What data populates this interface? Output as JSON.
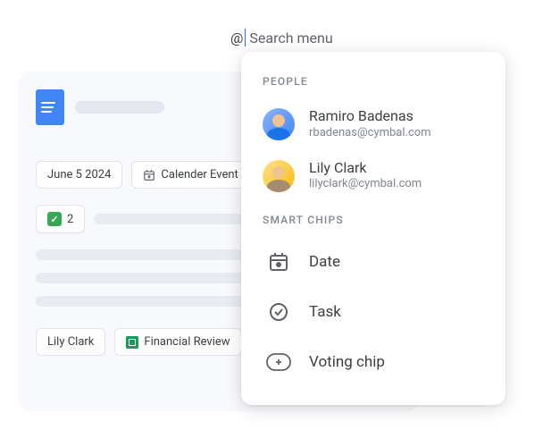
{
  "search": {
    "at": "@",
    "placeholder": "Search menu"
  },
  "doc": {
    "chips": {
      "date": "June 5 2024",
      "calendar": "Calender Event",
      "vote_count": "2",
      "person": "Lily Clark",
      "sheet": "Financial Review"
    }
  },
  "menu": {
    "sections": {
      "people_label": "PEOPLE",
      "smart_label": "SMART CHIPS"
    },
    "people": [
      {
        "name": "Ramiro Badenas",
        "email": "rbadenas@cymbal.com"
      },
      {
        "name": "Lily Clark",
        "email": "lilyclark@cymbal.com"
      }
    ],
    "smart_chips": {
      "date": "Date",
      "task": "Task",
      "voting": "Voting chip"
    }
  }
}
